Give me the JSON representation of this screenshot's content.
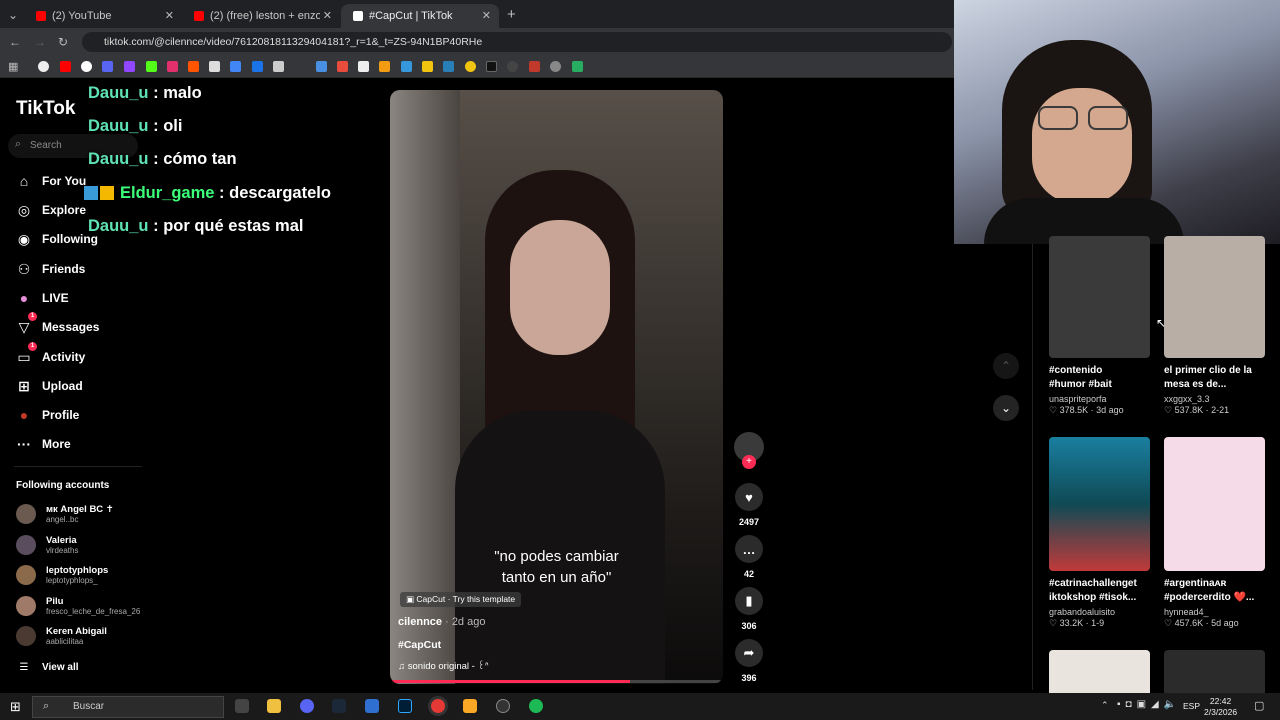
{
  "browser": {
    "tabs": [
      {
        "title": "(2) YouTube",
        "color": "#ff0000"
      },
      {
        "title": "(2) (free) leston + enzocerobulti",
        "color": "#ff0000"
      },
      {
        "title": "#CapCut | TikTok",
        "color": "#ffffff"
      }
    ],
    "url": "tiktok.com/@cilennce/video/7612081811329404181?_r=1&_t=ZS-94N1BP40RHe"
  },
  "sidebar": {
    "logo": "TikTok",
    "search_placeholder": "Search",
    "nav": [
      {
        "label": "For You",
        "icon": "home-icon"
      },
      {
        "label": "Explore",
        "icon": "compass-icon"
      },
      {
        "label": "Following",
        "icon": "following-icon"
      },
      {
        "label": "Friends",
        "icon": "friends-icon"
      },
      {
        "label": "LIVE",
        "icon": "live-icon"
      },
      {
        "label": "Messages",
        "icon": "messages-icon",
        "badge": "1"
      },
      {
        "label": "Activity",
        "icon": "activity-icon",
        "badge": "1"
      },
      {
        "label": "Upload",
        "icon": "upload-icon"
      },
      {
        "label": "Profile",
        "icon": "profile-icon"
      },
      {
        "label": "More",
        "icon": "more-icon"
      }
    ],
    "following_title": "Following accounts",
    "accounts": [
      {
        "name": "мк Angel BC ✝",
        "handle": "angel..bc"
      },
      {
        "name": "Valeria",
        "handle": "vlrdeaths"
      },
      {
        "name": "leptotyphlops",
        "handle": "leptotyphlops_"
      },
      {
        "name": "Pilu",
        "handle": "fresco_leche_de_fresa_26"
      },
      {
        "name": "Keren Abigail",
        "handle": "aablicilitaa"
      }
    ],
    "view_all": "View all"
  },
  "chat": [
    {
      "user": "Dauu_u",
      "msg": ": malo"
    },
    {
      "user": "Dauu_u",
      "msg": ": oli"
    },
    {
      "user": "Dauu_u",
      "msg": ": cómo tan"
    },
    {
      "user": "Eldur_game",
      "msg": ": descargatelo"
    },
    {
      "user": "Dauu_u",
      "msg": ": por qué estas mal"
    }
  ],
  "video": {
    "caption_line1": "\"no podes cambiar",
    "caption_line2": "tanto en un año\"",
    "template": "CapCut · Try this template",
    "author": "cilennce",
    "age": "· 2d ago",
    "hashtag": "#CapCut",
    "sound": "sonido original - ꒰ᐢ",
    "likes": "2497",
    "comments": "42",
    "saves": "306",
    "shares": "396",
    "progress": 0.72
  },
  "grid": [
    {
      "tag1": "#contenido",
      "tag2": "#humor #bait",
      "user": "unaspriteporfa",
      "stats": "♡ 378.5K · 3d ago",
      "color": "#3a3a3a"
    },
    {
      "tag1": "el primer clio de la",
      "tag2": "mesa es de...",
      "user": "xxggxx_3.3",
      "stats": "♡ 537.8K · 2-21",
      "color": "#b8aea5"
    },
    {
      "tag1": "#catrinachallenget",
      "tag2": "iktokshop #tisok...",
      "user": "grabandoaluisito",
      "stats": "♡ 33.2K · 1-9",
      "color": "#1b6e8a"
    },
    {
      "tag1": "#argentinaᴀʀ",
      "tag2": "#podercerdito ❤️...",
      "user": "hynnead4_",
      "stats": "♡ 457.6K · 5d ago",
      "color": "#f5dbe8"
    }
  ],
  "taskbar": {
    "search": "Buscar",
    "lang": "ESP",
    "time": "22:42",
    "date": "2/3/2026"
  }
}
